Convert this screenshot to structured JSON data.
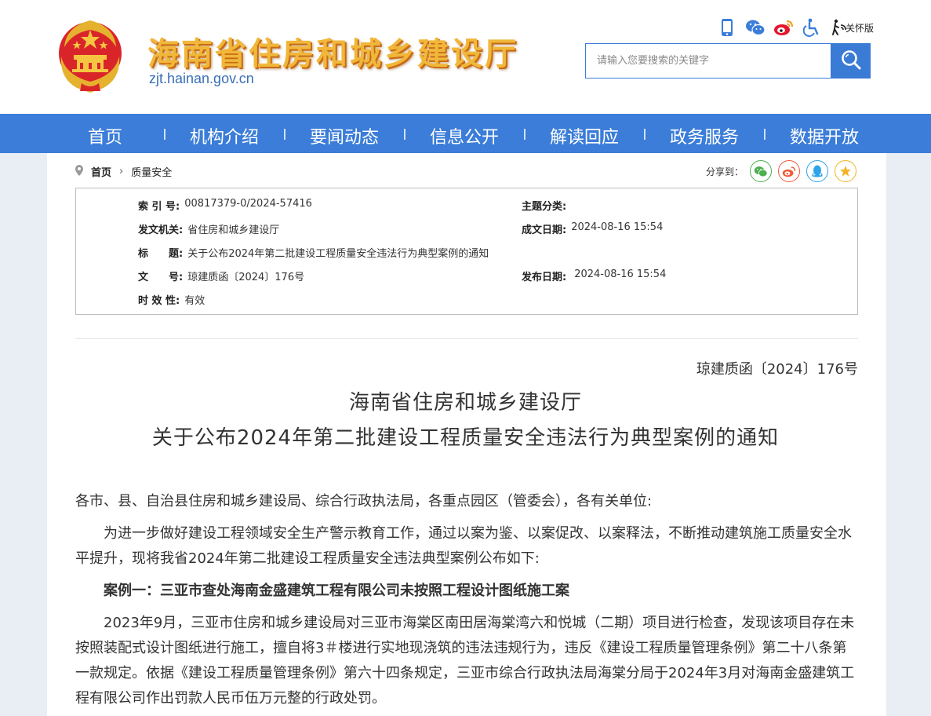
{
  "site": {
    "title": "海南省住房和城乡建设厅",
    "domain": "zjt.hainan.gov.cn",
    "care_mode": "关怀版"
  },
  "search": {
    "placeholder": "请输入您要搜索的关键字"
  },
  "nav": {
    "items": [
      "首页",
      "机构介绍",
      "要闻动态",
      "信息公开",
      "解读回应",
      "政务服务",
      "数据开放"
    ]
  },
  "breadcrumb": {
    "home": "首页",
    "separator": "›",
    "current": "质量安全"
  },
  "share": {
    "label": "分享到：",
    "icons": [
      "wechat-icon",
      "weibo-icon",
      "qq-icon",
      "qzone-icon"
    ]
  },
  "meta": {
    "index_label": "索 引 号:",
    "index_value": "00817379-0/2024-57416",
    "subject_label": "主题分类:",
    "subject_value": "",
    "issuer_label": "发文机关:",
    "issuer_value": "省住房和城乡建设厅",
    "date_written_label": "成文日期:",
    "date_written_value": "2024-08-16 15:54",
    "title_label": "标　　题:",
    "title_value": "关于公布2024年第二批建设工程质量安全违法行为典型案例的通知",
    "doc_no_label": "文　　号:",
    "doc_no_value": "琼建质函〔2024〕176号",
    "publish_date_label": "发布日期:",
    "publish_date_value": "2024-08-16 15:54",
    "validity_label": "时 效 性:",
    "validity_value": "有效"
  },
  "document": {
    "number": "琼建质函〔2024〕176号",
    "title_line1": "海南省住房和城乡建设厅",
    "title_line2": "关于公布2024年第二批建设工程质量安全违法行为典型案例的通知",
    "salutation": "各市、县、自治县住房和城乡建设局、综合行政执法局，各重点园区（管委会），各有关单位:",
    "para1": "为进一步做好建设工程领域安全生产警示教育工作，通过以案为鉴、以案促改、以案释法，不断推动建筑施工质量安全水平提升，现将我省2024年第二批建设工程质量安全违法典型案例公布如下:",
    "case1_heading": "案例一：三亚市查处海南金盛建筑工程有限公司未按照工程设计图纸施工案",
    "case1_text": "2023年9月，三亚市住房和城乡建设局对三亚市海棠区南田居海棠湾六和悦城（二期）项目进行检查，发现该项目存在未按照装配式设计图纸进行施工，擅自将3＃楼进行实地现浇筑的违法违规行为，违反《建设工程质量管理条例》第二十八条第一款规定。依据《建设工程质量管理条例》第六十四条规定，三亚市综合行政执法局海棠分局于2024年3月对海南金盛建筑工程有限公司作出罚款人民币伍万元整的行政处罚。"
  },
  "colors": {
    "nav_bg": "#3b7dd8",
    "title_gold": "#f0b73a",
    "domain_blue": "#3a6fb5",
    "page_bg": "#e9eef5"
  }
}
